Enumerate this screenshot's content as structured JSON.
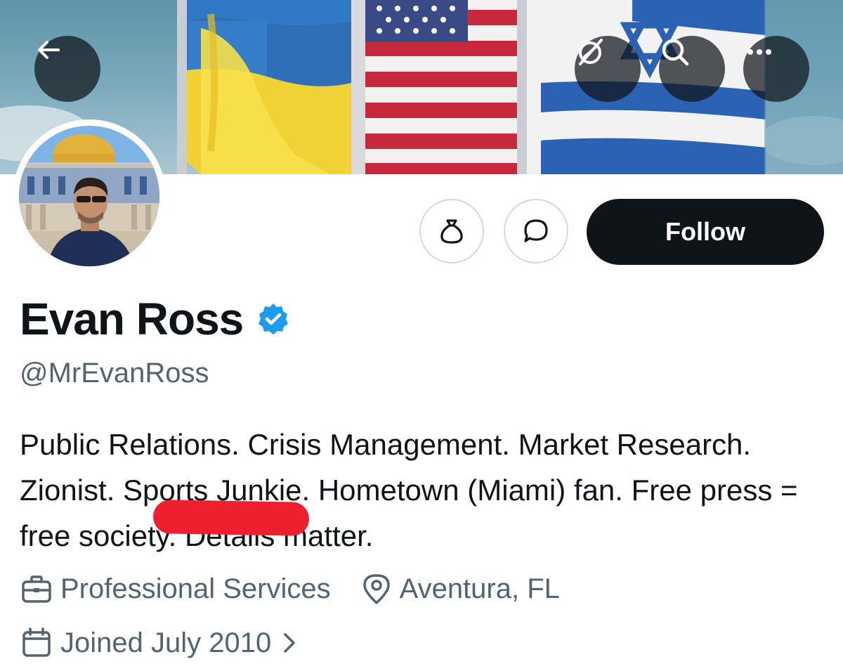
{
  "profile": {
    "display_name": "Evan Ross",
    "handle": "@MrEvanRoss",
    "bio": "Public Relations. Crisis Management. Market Research. Zionist. Sports Junkie. Hometown (Miami) fan. Free press = free society. Details matter.",
    "category": "Professional Services",
    "location": "Aventura, FL",
    "joined": "Joined July 2010",
    "verified": true
  },
  "actions": {
    "follow_label": "Follow"
  },
  "icons": {
    "back": "arrow-left-icon",
    "grok": "grok-icon",
    "search": "search-icon",
    "more": "more-dots-icon",
    "tip": "money-bag-icon",
    "message": "chat-bubble-icon",
    "category": "briefcase-icon",
    "location": "location-pin-icon",
    "joined": "calendar-icon",
    "verified": "verified-badge-icon"
  },
  "colors": {
    "accent": "#1d9bf0",
    "text_primary": "#0f1419",
    "text_secondary": "#536471",
    "follow_bg": "#0f1419",
    "redaction": "#ee1f2e"
  }
}
